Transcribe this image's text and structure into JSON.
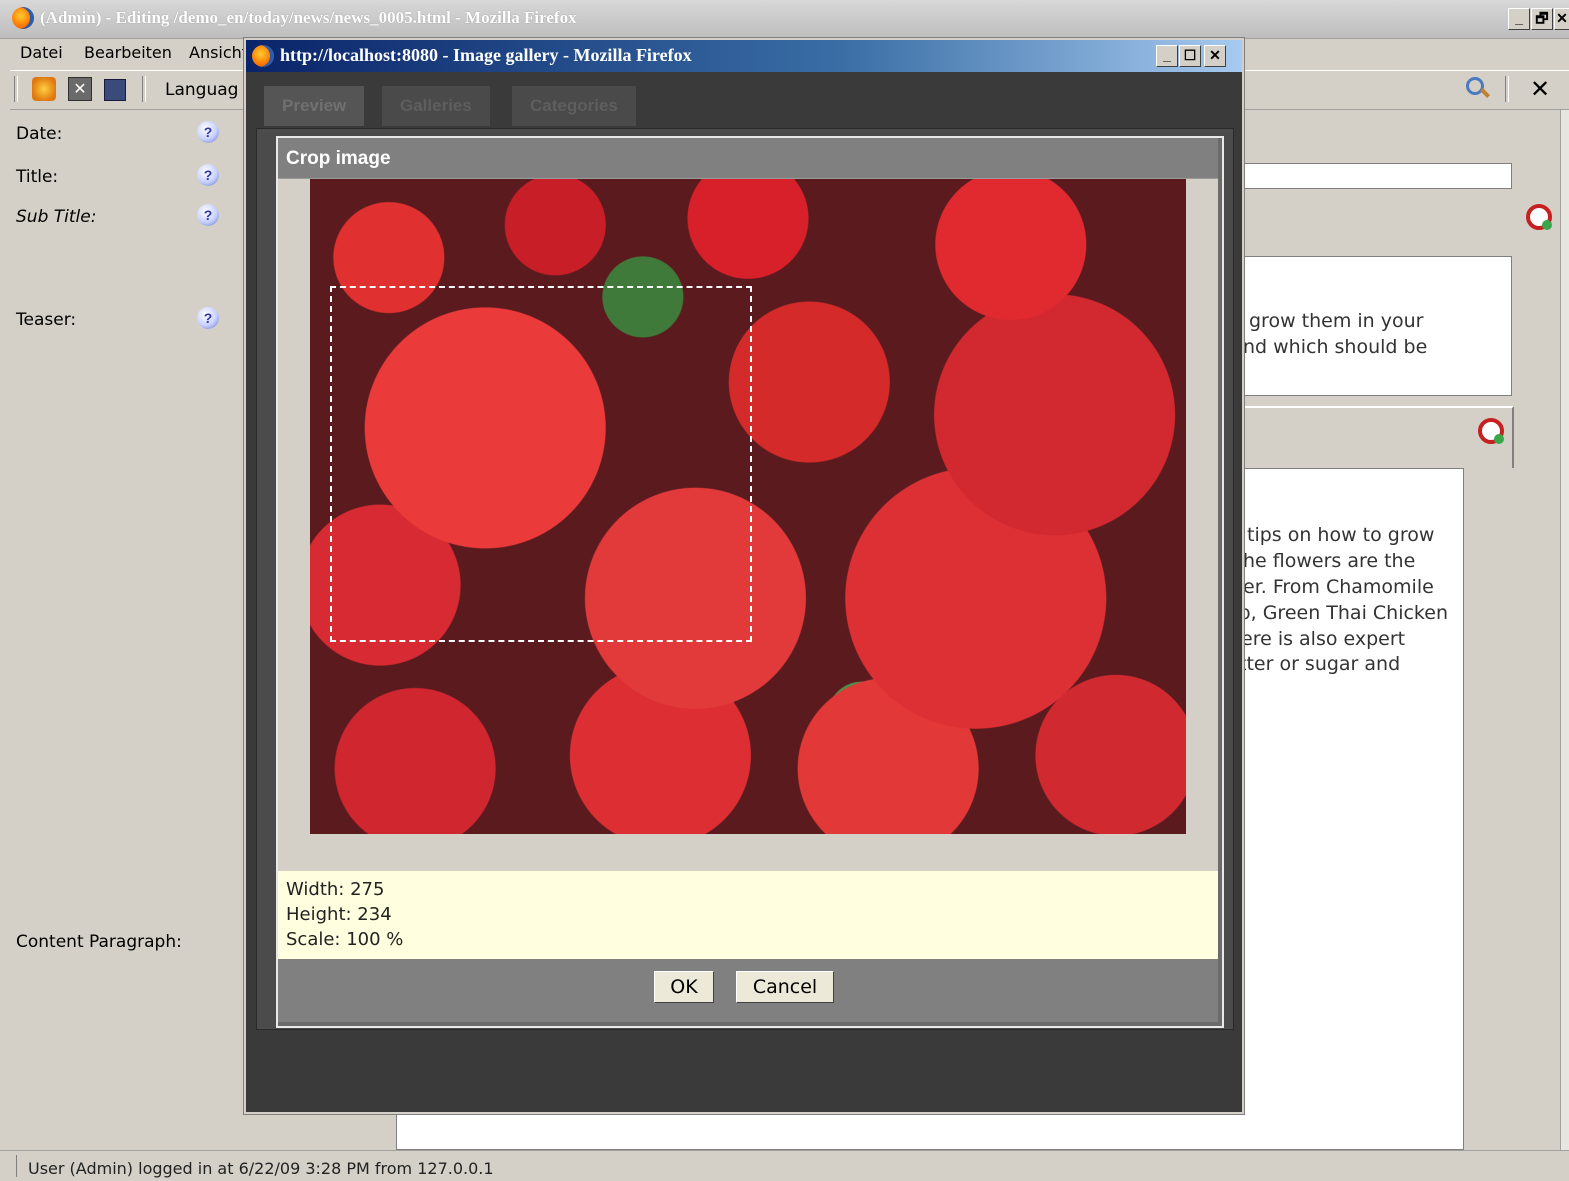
{
  "main_window": {
    "title": "(Admin) - Editing /demo_en/today/news/news_0005.html - Mozilla Firefox",
    "controls": {
      "minimize": "_",
      "restore": "🗗",
      "close": "✕"
    },
    "menu": [
      "Datei",
      "Bearbeiten",
      "Ansicht"
    ],
    "toolbar": {
      "language_label": "Languag",
      "close_glyph": "✕",
      "search_icon": "magnifier-icon"
    },
    "form": {
      "labels": {
        "date": "Date:",
        "title": "Title:",
        "sub_title": "Sub Title:",
        "teaser": "Teaser:",
        "content": "Content Paragraph:"
      },
      "help_glyph": "?",
      "teaser_fragments": [
        "grow them in your",
        "nd which should be"
      ],
      "content_fragments": [
        "tips on how to grow",
        "he flowers are the",
        "er. From Chamomile",
        "o, Green Thai Chicken",
        "ere is also expert",
        "tter or sugar and"
      ]
    },
    "status": "User (Admin) logged in at 6/22/09 3:28 PM from 127.0.0.1"
  },
  "popup": {
    "title": "http://localhost:8080 - Image gallery - Mozilla Firefox",
    "controls": {
      "minimize": "_",
      "maximize": "☐",
      "close": "✕"
    },
    "tabs": [
      "Preview",
      "Galleries",
      "Categories"
    ],
    "crop_dialog": {
      "title": "Crop image",
      "info": {
        "width": "Width: 275",
        "height": "Height: 234",
        "scale": "Scale: 100 %"
      },
      "ok_label": "OK",
      "cancel_label": "Cancel"
    }
  },
  "colors": {
    "popup_title_gradient_start": "#0a246a",
    "info_background": "#ffffe0",
    "dialog_gray": "#808080"
  }
}
